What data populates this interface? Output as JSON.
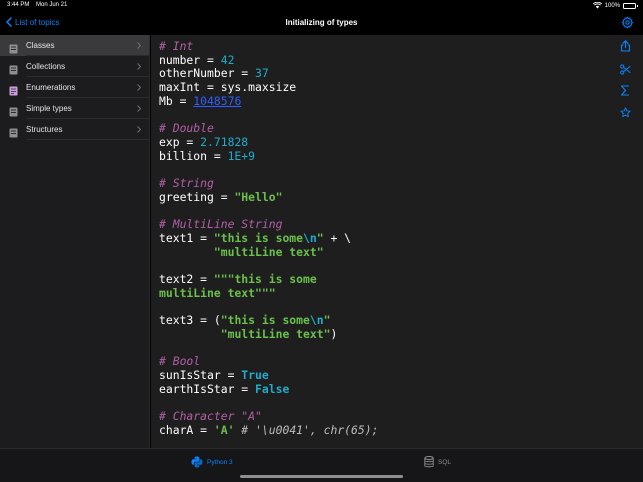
{
  "status": {
    "time": "3:44 PM",
    "date": "Mon Jun 21",
    "battery": "100%"
  },
  "nav": {
    "back_label": "List of topics",
    "title": "Initializing of types"
  },
  "sidebar": {
    "items": [
      {
        "label": "Classes",
        "selected": true,
        "icon_color": "#8e8e93"
      },
      {
        "label": "Collections",
        "selected": false,
        "icon_color": "#8e8e93"
      },
      {
        "label": "Enumerations",
        "selected": false,
        "icon_color": "#c9a0dc"
      },
      {
        "label": "Simple types",
        "selected": false,
        "icon_color": "#8e8e93"
      },
      {
        "label": "Structures",
        "selected": false,
        "icon_color": "#8e8e93"
      }
    ]
  },
  "code": {
    "l1": "# Int",
    "l2a": "number = ",
    "l2b": "42",
    "l3a": "otherNumber = ",
    "l3b": "37",
    "l4": "maxInt = sys.maxsize",
    "l5a": "Mb = ",
    "l5b": "1048576",
    "l7": "# Double",
    "l8a": "exp = ",
    "l8b": "2.71828",
    "l9a": "billion = ",
    "l9b": "1E+9",
    "l11": "# String",
    "l12a": "greeting = ",
    "l12b": "\"Hello\"",
    "l14": "# MultiLine String",
    "l15a": "text1 = ",
    "l15b": "\"this is some",
    "l15c": "\\n",
    "l15d": "\"",
    "l15e": " + \\",
    "l16a": "        ",
    "l16b": "\"multiLine text\"",
    "l18a": "text2 = ",
    "l18b": "\"\"\"this is some",
    "l19": "multiLine text\"\"\"",
    "l21a": "text3 = (",
    "l21b": "\"this is some",
    "l21c": "\\n",
    "l21d": "\"",
    "l22a": "         ",
    "l22b": "\"multiLine text\"",
    "l22c": ")",
    "l24": "# Bool",
    "l25a": "sunIsStar = ",
    "l25b": "True",
    "l26a": "earthIsStar = ",
    "l26b": "False",
    "l28": "# Character \"A\"",
    "l29a": "charA = ",
    "l29b": "'A'",
    "l29c": " # '\\u0041', chr(65);"
  },
  "tabs": {
    "python_label": "Python 3",
    "sql_label": "SQL"
  },
  "colors": {
    "accent": "#0a84ff",
    "comment": "#b35fa8",
    "number": "#1eaccd",
    "string": "#6ac14b"
  }
}
